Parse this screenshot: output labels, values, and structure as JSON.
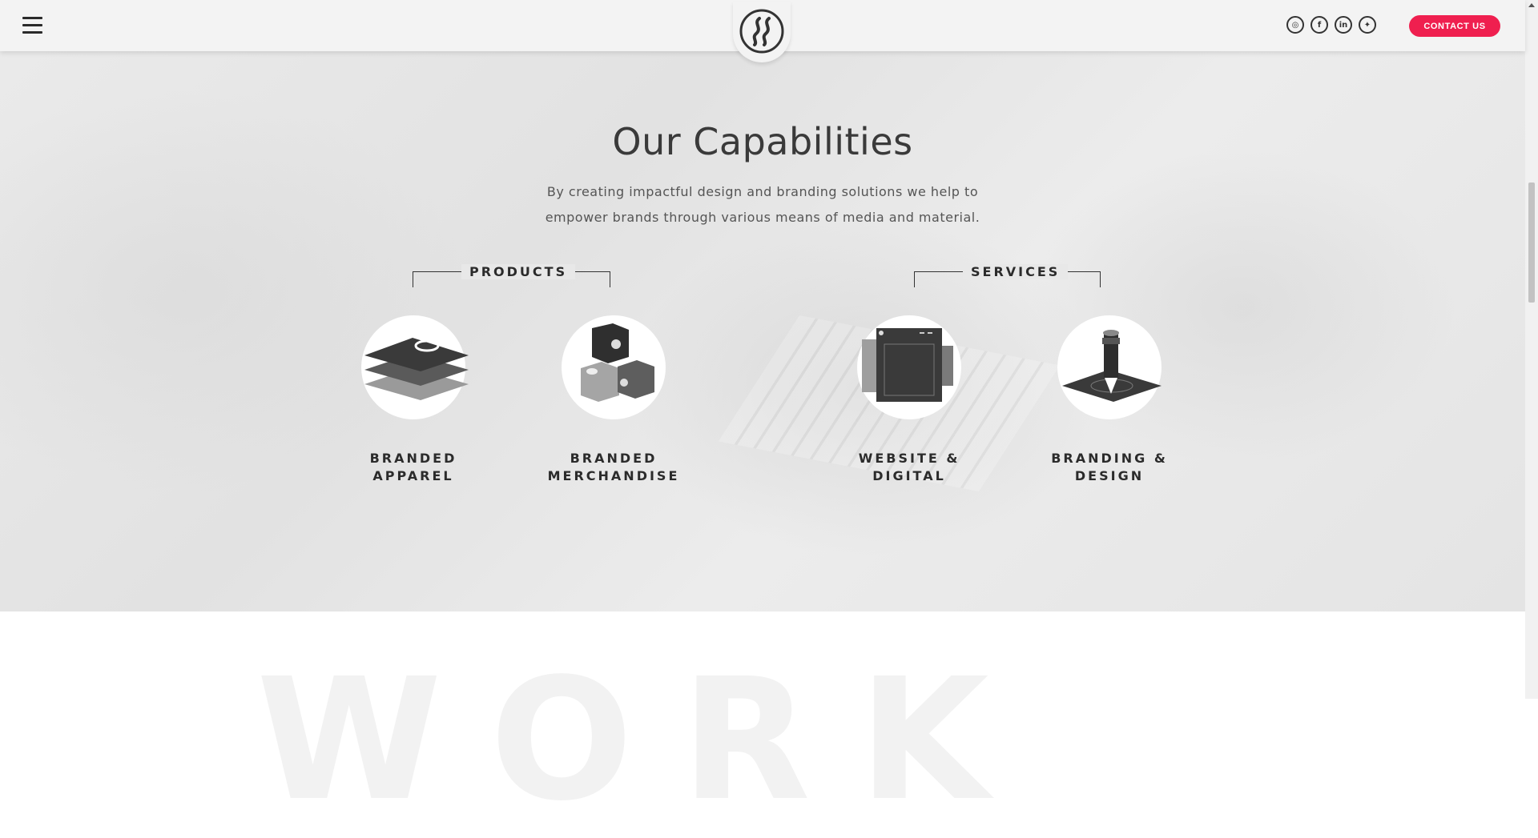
{
  "header": {
    "menu_icon": "hamburger-icon",
    "logo_icon": "ss-logo-icon",
    "socials": [
      {
        "name": "instagram",
        "glyph": "◎"
      },
      {
        "name": "facebook",
        "glyph": "f"
      },
      {
        "name": "linkedin",
        "glyph": "in"
      },
      {
        "name": "twitter",
        "glyph": "✦"
      }
    ],
    "contact_label": "CONTACT US"
  },
  "main": {
    "title": "Our Capabilities",
    "subtitle_line1": "By creating impactful design and branding solutions we help to",
    "subtitle_line2": "empower brands through various means of media and material.",
    "groups": [
      {
        "label": "PRODUCTS",
        "items": [
          {
            "line1": "BRANDED",
            "line2": "APPAREL"
          },
          {
            "line1": "BRANDED",
            "line2": "MERCHANDISE"
          }
        ]
      },
      {
        "label": "SERVICES",
        "items": [
          {
            "line1": "WEBSITE &",
            "line2": "DIGITAL"
          },
          {
            "line1": "BRANDING &",
            "line2": "DESIGN"
          }
        ]
      }
    ]
  },
  "next_section": {
    "watermark": "WORK"
  },
  "colors": {
    "accent": "#ef1f4f",
    "text_dark": "#2b2b2b",
    "header_bg": "#f3f3f3"
  }
}
